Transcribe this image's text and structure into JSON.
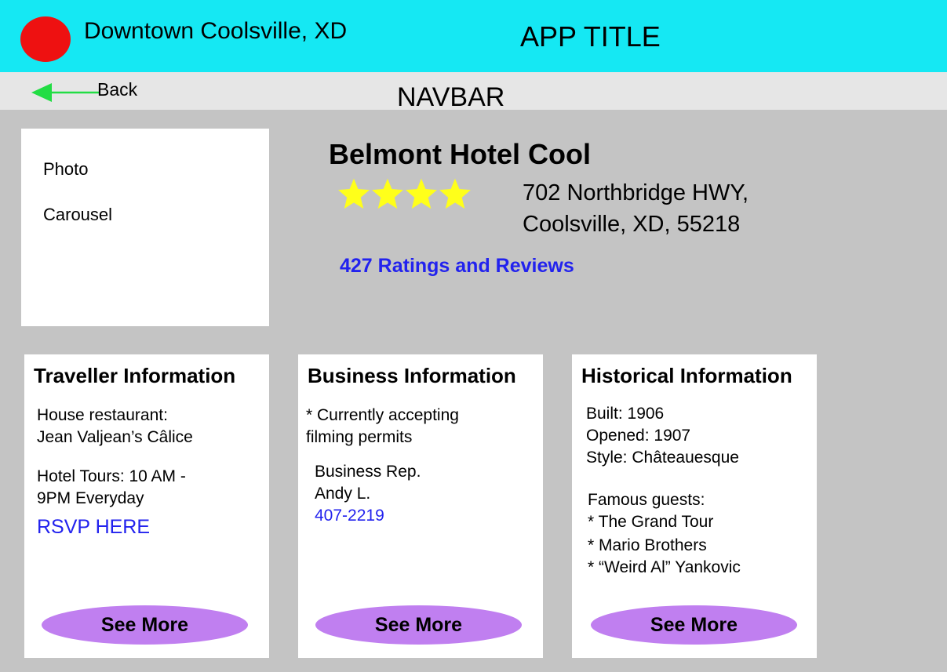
{
  "header": {
    "location": "Downtown Coolsville, XD",
    "app_title": "APP TITLE",
    "avatar_color": "#ee1111",
    "background": "#15e8f3"
  },
  "navbar": {
    "back_label": "Back",
    "title": "NAVBAR",
    "back_arrow_color": "#22dd44"
  },
  "carousel": {
    "line1": "Photo",
    "line2": "Carousel"
  },
  "hotel": {
    "name": "Belmont Hotel Cool",
    "star_rating": 4,
    "address_line1": "702 Northbridge HWY,",
    "address_line2": "Coolsville, XD, 55218",
    "ratings_link": "427 Ratings and Reviews"
  },
  "cards": [
    {
      "title": "Traveller Information",
      "lines": [
        "House restaurant:",
        "Jean Valjean’s Câlice",
        "Hotel Tours: 10 AM -",
        "9PM Everyday"
      ],
      "link": "RSVP HERE",
      "button": "See More"
    },
    {
      "title": "Business Information",
      "lines": [
        "* Currently accepting",
        "filming permits",
        "Business Rep.",
        "Andy L."
      ],
      "link": "407-2219",
      "button": "See More"
    },
    {
      "title": "Historical Information",
      "lines": [
        "Built: 1906",
        "Opened: 1907",
        "Style:  Châteauesque",
        "Famous guests:",
        "* The Grand Tour",
        "* Mario Brothers",
        "* “Weird Al” Yankovic"
      ],
      "button": "See More"
    }
  ],
  "colors": {
    "link": "#2222ee",
    "button": "#c07ff0",
    "star": "#ffff1a"
  }
}
